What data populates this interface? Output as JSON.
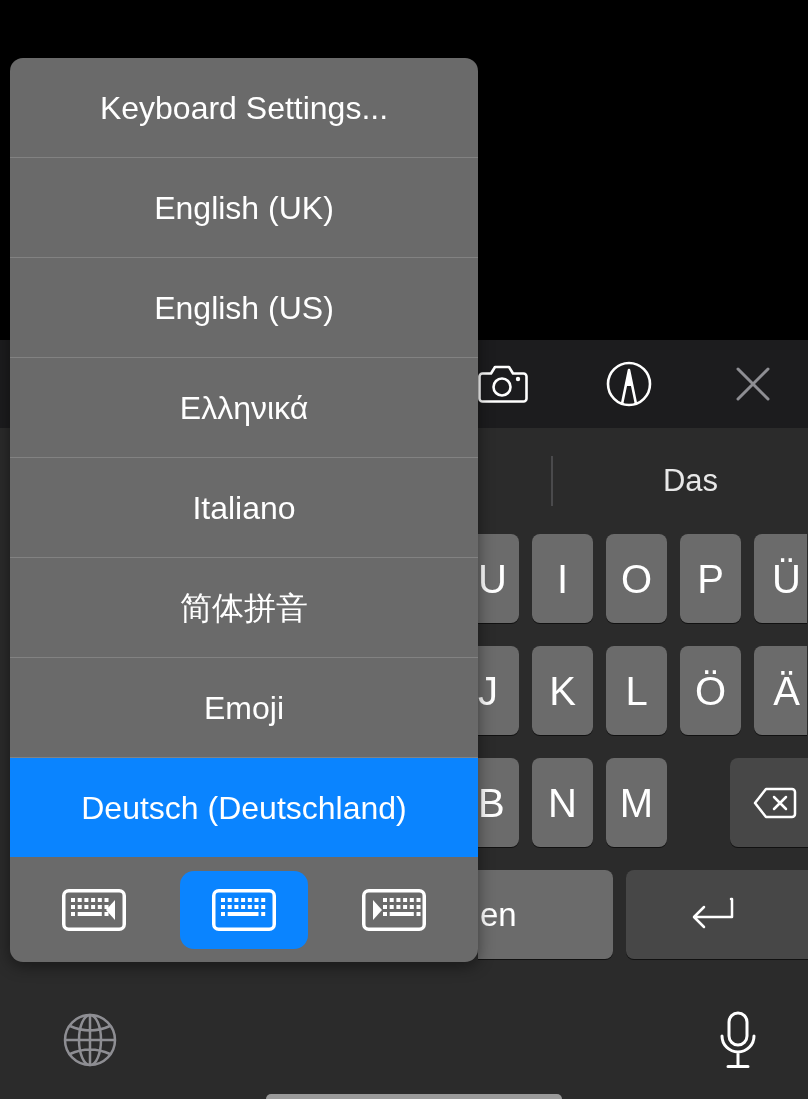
{
  "popup_menu": {
    "items": [
      {
        "label": "Keyboard Settings...",
        "selected": false
      },
      {
        "label": "English (UK)",
        "selected": false
      },
      {
        "label": "English (US)",
        "selected": false
      },
      {
        "label": "Ελληνικά",
        "selected": false
      },
      {
        "label": "Italiano",
        "selected": false
      },
      {
        "label": "简体拼音",
        "selected": false
      },
      {
        "label": "Emoji",
        "selected": false
      },
      {
        "label": "Deutsch (Deutschland)",
        "selected": true
      }
    ],
    "layout_buttons": [
      {
        "kind": "left",
        "selected": false
      },
      {
        "kind": "center",
        "selected": true
      },
      {
        "kind": "right",
        "selected": false
      }
    ]
  },
  "suggestion_bar": {
    "suggestions": [
      "Das"
    ]
  },
  "keyboard": {
    "rows": [
      [
        {
          "kind": "letter",
          "label": "U"
        },
        {
          "kind": "letter",
          "label": "I"
        },
        {
          "kind": "letter",
          "label": "O"
        },
        {
          "kind": "letter",
          "label": "P"
        },
        {
          "kind": "letter",
          "label": "Ü"
        }
      ],
      [
        {
          "kind": "letter",
          "label": "J"
        },
        {
          "kind": "letter",
          "label": "K"
        },
        {
          "kind": "letter",
          "label": "L"
        },
        {
          "kind": "letter",
          "label": "Ö"
        },
        {
          "kind": "letter",
          "label": "Ä"
        }
      ],
      [
        {
          "kind": "letter",
          "label": "B"
        },
        {
          "kind": "letter",
          "label": "N"
        },
        {
          "kind": "letter",
          "label": "M"
        },
        {
          "kind": "delete"
        }
      ],
      [
        {
          "kind": "space",
          "label": "en"
        },
        {
          "kind": "return"
        }
      ]
    ]
  }
}
